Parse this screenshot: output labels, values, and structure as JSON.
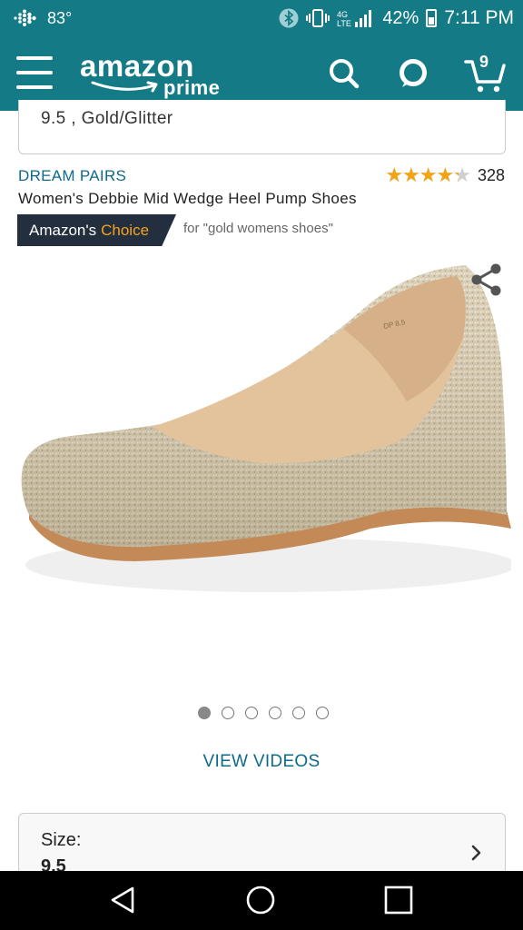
{
  "status_bar": {
    "temperature": "83°",
    "battery": "42%",
    "time": "7:11 PM",
    "icons": [
      "fitbit-icon",
      "bluetooth-icon",
      "vibrate-icon",
      "signal-icon",
      "battery-icon"
    ]
  },
  "header": {
    "logo_text": "amazon",
    "logo_sub": "prime",
    "cart_count": "9",
    "colors": {
      "background": "#147b86",
      "text": "#ffffff"
    }
  },
  "selection_card": {
    "text": "9.5 , Gold/Glitter"
  },
  "product": {
    "brand": "DREAM PAIRS",
    "title": "Women's Debbie Mid Wedge Heel Pump Shoes",
    "rating": 4.3,
    "rating_max": 5,
    "rating_count": "328",
    "badge": {
      "prefix": "Amazon's",
      "highlight": "Choice",
      "for_text": "for \"gold womens shoes\""
    }
  },
  "carousel": {
    "total": 6,
    "active_index": 0
  },
  "view_videos_label": "VIEW VIDEOS",
  "size_card": {
    "label": "Size:",
    "value": "9.5"
  },
  "colors": {
    "link": "#0f6a8a",
    "star": "#f3a416",
    "badge_bg": "#232f3e",
    "badge_highlight": "#f6a21d"
  }
}
